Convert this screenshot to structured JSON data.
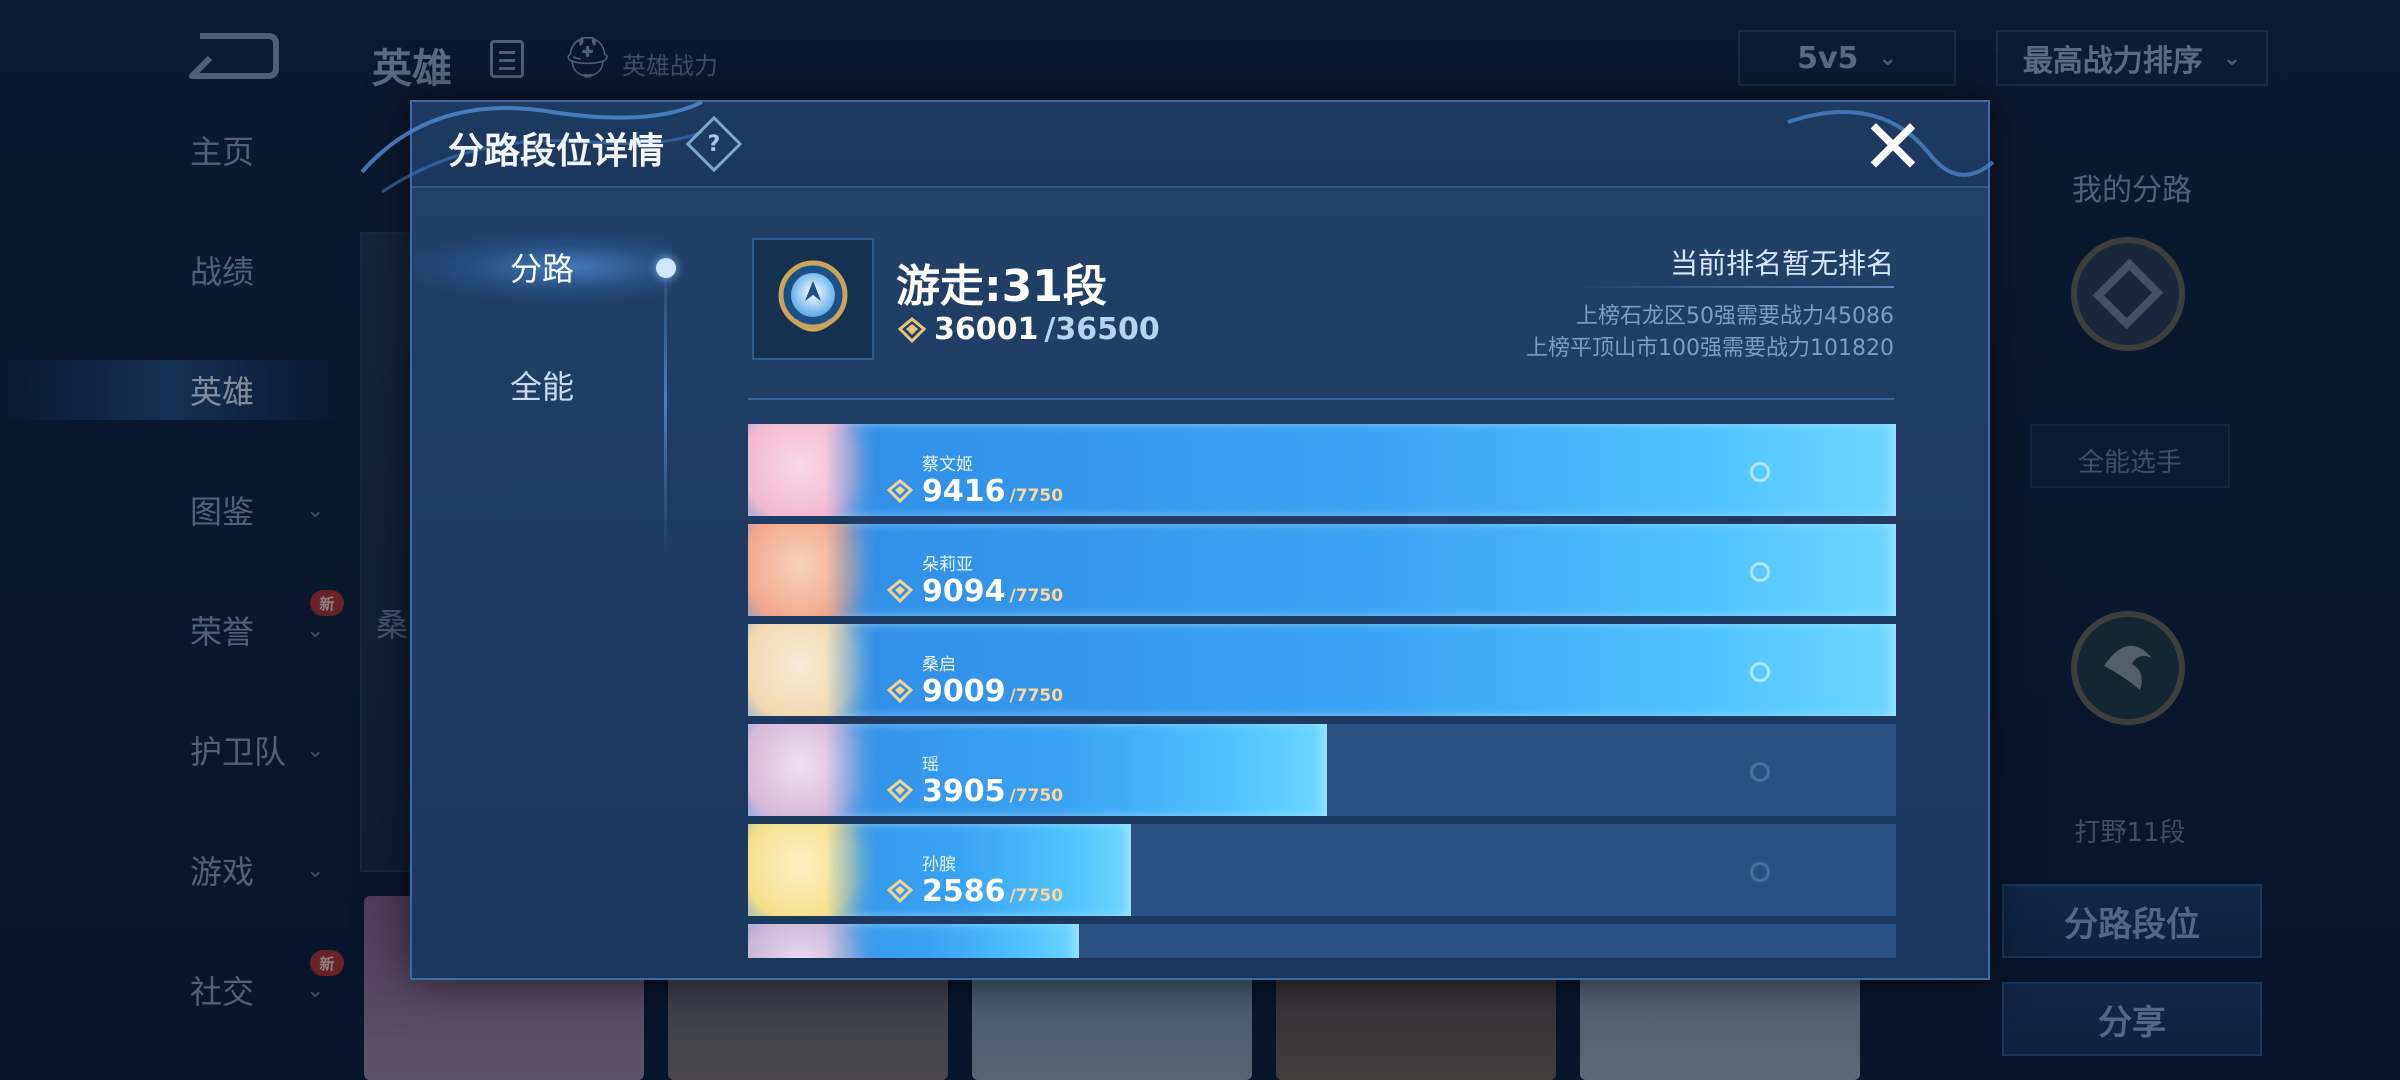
{
  "background": {
    "title": "英雄",
    "subtitle": "英雄战力",
    "mode_dropdown": "5v5",
    "sort_dropdown": "最高战力排序",
    "nav": [
      {
        "label": "主页",
        "has_chevron": false,
        "active": false,
        "new": false
      },
      {
        "label": "战绩",
        "has_chevron": false,
        "active": false,
        "new": false
      },
      {
        "label": "英雄",
        "has_chevron": false,
        "active": true,
        "new": false
      },
      {
        "label": "图鉴",
        "has_chevron": true,
        "active": false,
        "new": false
      },
      {
        "label": "荣誉",
        "has_chevron": true,
        "active": false,
        "new": true
      },
      {
        "label": "护卫队",
        "has_chevron": true,
        "active": false,
        "new": false
      },
      {
        "label": "游戏",
        "has_chevron": true,
        "active": false,
        "new": false
      },
      {
        "label": "社交",
        "has_chevron": true,
        "active": false,
        "new": true
      }
    ],
    "new_badge": "新",
    "card_partial_label": "桑",
    "right_panel": {
      "title": "我的分路",
      "badge1_label": "全能选手",
      "badge2_label": "打野11段",
      "lane_rank_button": "分路段位",
      "share_button": "分享"
    }
  },
  "modal": {
    "title": "分路段位详情",
    "help_icon": "?",
    "close_icon": "✕",
    "tabs": [
      {
        "label": "分路",
        "active": true
      },
      {
        "label": "全能",
        "active": false
      }
    ],
    "lane": {
      "name": "游走:31段",
      "current_power": "36001",
      "max_power": "/36500"
    },
    "ranking": {
      "main": "当前排名暂无排名",
      "line1": "上榜石龙区50强需要战力45086",
      "line2": "上榜平顶山市100强需要战力101820"
    },
    "heroes": [
      {
        "name": "蔡文姬",
        "power": "9416",
        "max": "/7750",
        "fill": 1.0
      },
      {
        "name": "朵莉亚",
        "power": "9094",
        "max": "/7750",
        "fill": 1.0
      },
      {
        "name": "桑启",
        "power": "9009",
        "max": "/7750",
        "fill": 1.0
      },
      {
        "name": "瑶",
        "power": "3905",
        "max": "/7750",
        "fill": 0.504
      },
      {
        "name": "孙膑",
        "power": "2586",
        "max": "/7750",
        "fill": 0.334
      },
      {
        "name": "",
        "power": "",
        "max": "",
        "fill": 0.288
      }
    ]
  },
  "colors": {
    "accent": "#3aa2f2",
    "panel": "#1f3b63",
    "max_text": "#ffd79a"
  }
}
